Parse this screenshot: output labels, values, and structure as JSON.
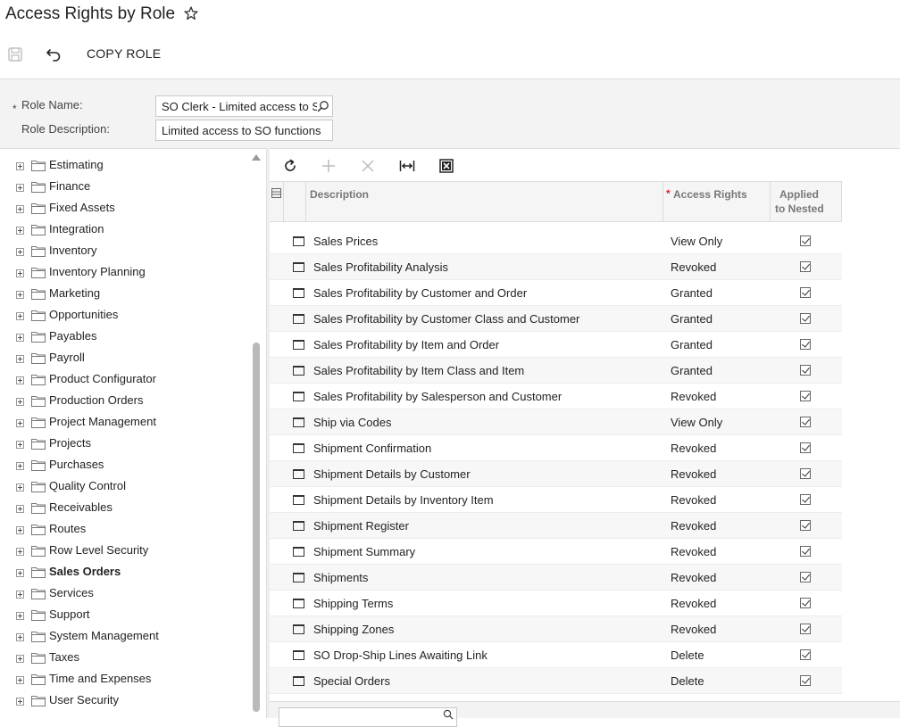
{
  "page": {
    "title": "Access Rights by Role"
  },
  "toolbar": {
    "copy_role_label": "COPY ROLE"
  },
  "form": {
    "role_name_label": "Role Name:",
    "role_name_value": "SO Clerk - Limited access to SO",
    "role_description_label": "Role Description:",
    "role_description_value": "Limited access to SO functions"
  },
  "tree": {
    "items": [
      {
        "label": "Estimating",
        "bold": false
      },
      {
        "label": "Finance",
        "bold": false
      },
      {
        "label": "Fixed Assets",
        "bold": false
      },
      {
        "label": "Integration",
        "bold": false
      },
      {
        "label": "Inventory",
        "bold": false
      },
      {
        "label": "Inventory Planning",
        "bold": false
      },
      {
        "label": "Marketing",
        "bold": false
      },
      {
        "label": "Opportunities",
        "bold": false
      },
      {
        "label": "Payables",
        "bold": false
      },
      {
        "label": "Payroll",
        "bold": false
      },
      {
        "label": "Product Configurator",
        "bold": false
      },
      {
        "label": "Production Orders",
        "bold": false
      },
      {
        "label": "Project Management",
        "bold": false
      },
      {
        "label": "Projects",
        "bold": false
      },
      {
        "label": "Purchases",
        "bold": false
      },
      {
        "label": "Quality Control",
        "bold": false
      },
      {
        "label": "Receivables",
        "bold": false
      },
      {
        "label": "Routes",
        "bold": false
      },
      {
        "label": "Row Level Security",
        "bold": false
      },
      {
        "label": "Sales Orders",
        "bold": true
      },
      {
        "label": "Services",
        "bold": false
      },
      {
        "label": "Support",
        "bold": false
      },
      {
        "label": "System Management",
        "bold": false
      },
      {
        "label": "Taxes",
        "bold": false
      },
      {
        "label": "Time and Expenses",
        "bold": false
      },
      {
        "label": "User Security",
        "bold": false
      }
    ]
  },
  "grid": {
    "columns": {
      "description": "Description",
      "access_rights_required": "*",
      "access_rights": "Access Rights",
      "applied_line1": "Applied",
      "applied_line2": "to Nested"
    },
    "rows": [
      {
        "description": "Sales Prices",
        "access": "View Only",
        "applied": true
      },
      {
        "description": "Sales Profitability Analysis",
        "access": "Revoked",
        "applied": true
      },
      {
        "description": "Sales Profitability by Customer and Order",
        "access": "Granted",
        "applied": true
      },
      {
        "description": "Sales Profitability by Customer Class and Customer",
        "access": "Granted",
        "applied": true
      },
      {
        "description": "Sales Profitability by Item and Order",
        "access": "Granted",
        "applied": true
      },
      {
        "description": "Sales Profitability by Item Class and Item",
        "access": "Granted",
        "applied": true
      },
      {
        "description": "Sales Profitability by Salesperson and Customer",
        "access": "Revoked",
        "applied": true
      },
      {
        "description": "Ship via Codes",
        "access": "View Only",
        "applied": true
      },
      {
        "description": "Shipment Confirmation",
        "access": "Revoked",
        "applied": true
      },
      {
        "description": "Shipment Details by Customer",
        "access": "Revoked",
        "applied": true
      },
      {
        "description": "Shipment Details by Inventory Item",
        "access": "Revoked",
        "applied": true
      },
      {
        "description": "Shipment Register",
        "access": "Revoked",
        "applied": true
      },
      {
        "description": "Shipment Summary",
        "access": "Revoked",
        "applied": true
      },
      {
        "description": "Shipments",
        "access": "Revoked",
        "applied": true
      },
      {
        "description": "Shipping Terms",
        "access": "Revoked",
        "applied": true
      },
      {
        "description": "Shipping Zones",
        "access": "Revoked",
        "applied": true
      },
      {
        "description": "SO Drop-Ship Lines Awaiting Link",
        "access": "Delete",
        "applied": true
      },
      {
        "description": "Special Orders",
        "access": "Delete",
        "applied": true
      }
    ]
  }
}
